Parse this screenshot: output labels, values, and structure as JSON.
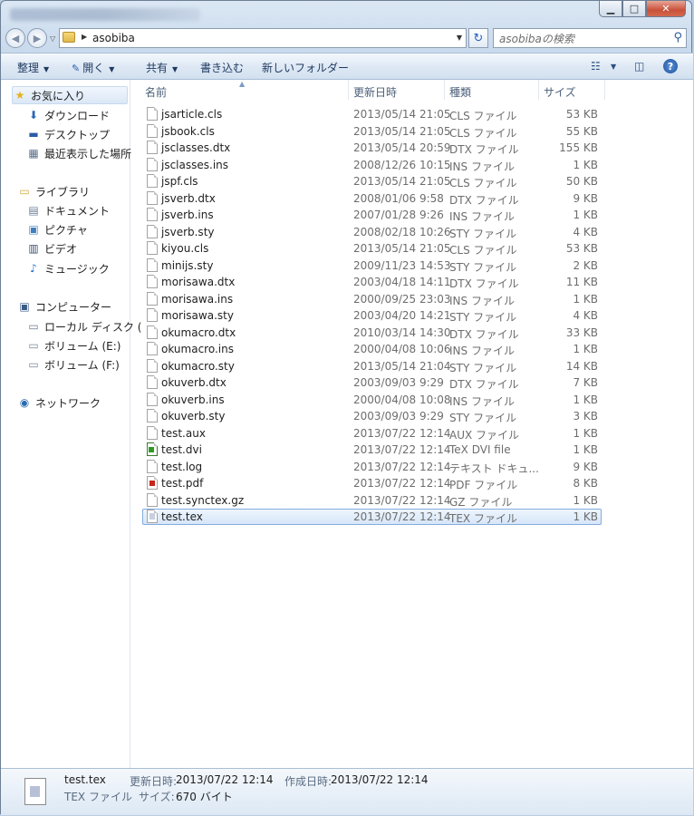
{
  "window": {
    "caption": {
      "minimize": "▁",
      "maximize": "□",
      "close": "✕"
    }
  },
  "address": {
    "path": "asobiba",
    "search_placeholder": "asobibaの検索"
  },
  "toolbar": {
    "organize": "整理",
    "open": "開く",
    "share": "共有",
    "burn": "書き込む",
    "new_folder": "新しいフォルダー",
    "help": "?"
  },
  "nav": {
    "favorites": "お気に入り",
    "downloads": "ダウンロード",
    "desktop": "デスクトップ",
    "recent": "最近表示した場所",
    "libraries": "ライブラリ",
    "documents": "ドキュメント",
    "pictures": "ピクチャ",
    "videos": "ビデオ",
    "music": "ミュージック",
    "computer": "コンピューター",
    "local_disk": "ローカル ディスク (",
    "volume_e": "ボリューム (E:)",
    "volume_f": "ボリューム (F:)",
    "network": "ネットワーク"
  },
  "columns": {
    "name": "名前",
    "date": "更新日時",
    "type": "種類",
    "size": "サイズ"
  },
  "files": [
    {
      "name": "jsarticle.cls",
      "date": "2013/05/14 21:05",
      "type": "CLS ファイル",
      "size": "53 KB"
    },
    {
      "name": "jsbook.cls",
      "date": "2013/05/14 21:05",
      "type": "CLS ファイル",
      "size": "55 KB"
    },
    {
      "name": "jsclasses.dtx",
      "date": "2013/05/14 20:59",
      "type": "DTX ファイル",
      "size": "155 KB"
    },
    {
      "name": "jsclasses.ins",
      "date": "2008/12/26 10:15",
      "type": "INS ファイル",
      "size": "1 KB"
    },
    {
      "name": "jspf.cls",
      "date": "2013/05/14 21:05",
      "type": "CLS ファイル",
      "size": "50 KB"
    },
    {
      "name": "jsverb.dtx",
      "date": "2008/01/06 9:58",
      "type": "DTX ファイル",
      "size": "9 KB"
    },
    {
      "name": "jsverb.ins",
      "date": "2007/01/28 9:26",
      "type": "INS ファイル",
      "size": "1 KB"
    },
    {
      "name": "jsverb.sty",
      "date": "2008/02/18 10:26",
      "type": "STY ファイル",
      "size": "4 KB"
    },
    {
      "name": "kiyou.cls",
      "date": "2013/05/14 21:05",
      "type": "CLS ファイル",
      "size": "53 KB"
    },
    {
      "name": "minijs.sty",
      "date": "2009/11/23 14:53",
      "type": "STY ファイル",
      "size": "2 KB"
    },
    {
      "name": "morisawa.dtx",
      "date": "2003/04/18 14:11",
      "type": "DTX ファイル",
      "size": "11 KB"
    },
    {
      "name": "morisawa.ins",
      "date": "2000/09/25 23:03",
      "type": "INS ファイル",
      "size": "1 KB"
    },
    {
      "name": "morisawa.sty",
      "date": "2003/04/20 14:21",
      "type": "STY ファイル",
      "size": "4 KB"
    },
    {
      "name": "okumacro.dtx",
      "date": "2010/03/14 14:30",
      "type": "DTX ファイル",
      "size": "33 KB"
    },
    {
      "name": "okumacro.ins",
      "date": "2000/04/08 10:06",
      "type": "INS ファイル",
      "size": "1 KB"
    },
    {
      "name": "okumacro.sty",
      "date": "2013/05/14 21:04",
      "type": "STY ファイル",
      "size": "14 KB"
    },
    {
      "name": "okuverb.dtx",
      "date": "2003/09/03 9:29",
      "type": "DTX ファイル",
      "size": "7 KB"
    },
    {
      "name": "okuverb.ins",
      "date": "2000/04/08 10:08",
      "type": "INS ファイル",
      "size": "1 KB"
    },
    {
      "name": "okuverb.sty",
      "date": "2003/09/03 9:29",
      "type": "STY ファイル",
      "size": "3 KB"
    },
    {
      "name": "test.aux",
      "date": "2013/07/22 12:14",
      "type": "AUX ファイル",
      "size": "1 KB"
    },
    {
      "name": "test.dvi",
      "date": "2013/07/22 12:14",
      "type": "TeX DVI file",
      "size": "1 KB",
      "icon": "dvi"
    },
    {
      "name": "test.log",
      "date": "2013/07/22 12:14",
      "type": "テキスト ドキュ...",
      "size": "9 KB"
    },
    {
      "name": "test.pdf",
      "date": "2013/07/22 12:14",
      "type": "PDF ファイル",
      "size": "8 KB",
      "icon": "pdf"
    },
    {
      "name": "test.synctex.gz",
      "date": "2013/07/22 12:14",
      "type": "GZ ファイル",
      "size": "1 KB"
    },
    {
      "name": "test.tex",
      "date": "2013/07/22 12:14",
      "type": "TEX ファイル",
      "size": "1 KB",
      "icon": "tex",
      "selected": true
    }
  ],
  "details": {
    "filename": "test.tex",
    "modified_label": "更新日時:",
    "modified_value": "2013/07/22 12:14",
    "created_label": "作成日時:",
    "created_value": "2013/07/22 12:14",
    "type": "TEX ファイル",
    "size_label": "サイズ:",
    "size_value": "670 バイト"
  }
}
